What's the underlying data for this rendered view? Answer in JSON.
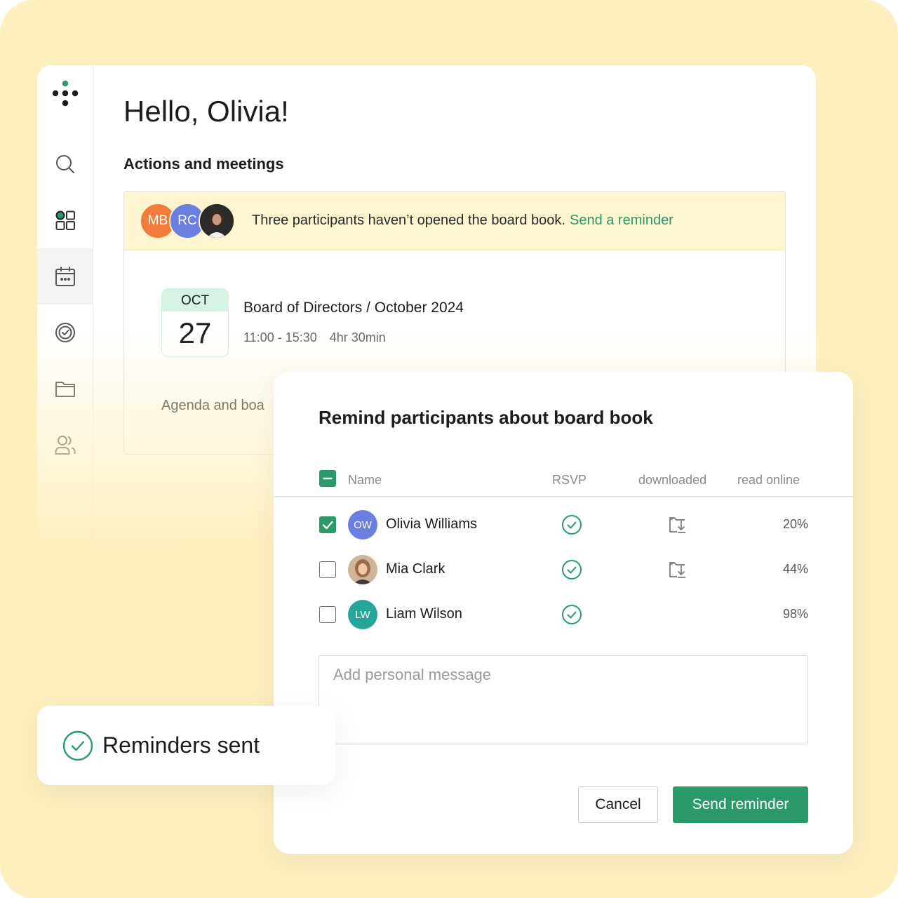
{
  "app": {
    "greeting": "Hello, Olivia!",
    "section_title": "Actions and meetings",
    "sidebar": {
      "items": [
        {
          "name": "search",
          "icon": "search-icon"
        },
        {
          "name": "dashboard",
          "icon": "grid-icon"
        },
        {
          "name": "calendar",
          "icon": "calendar-icon",
          "active": true
        },
        {
          "name": "tasks",
          "icon": "check-circle-icon"
        },
        {
          "name": "files",
          "icon": "folder-icon"
        },
        {
          "name": "people",
          "icon": "users-icon"
        }
      ]
    }
  },
  "notice": {
    "avatars": [
      {
        "initials": "MB",
        "color": "#f27c3a"
      },
      {
        "initials": "RC",
        "color": "#6b7fe0"
      },
      {
        "initials": "",
        "kind": "photo"
      }
    ],
    "text": "Three participants haven’t opened the board book.",
    "link": "Send a reminder"
  },
  "meeting": {
    "month": "OCT",
    "day": "27",
    "title": "Board of Directors / October 2024",
    "time": "11:00 - 15:30",
    "duration": "4hr 30min",
    "agenda_label": "Agenda and boa"
  },
  "modal": {
    "title": "Remind participants about board book",
    "columns": {
      "name": "Name",
      "rsvp": "RSVP",
      "downloaded": "downloaded",
      "read_online": "read online"
    },
    "header_checkbox": "indeterminate",
    "rows": [
      {
        "name": "Olivia Williams",
        "initials": "OW",
        "avatar_color": "#6b7fe0",
        "checked": true,
        "rsvp": true,
        "downloaded": true,
        "read_online": "20%"
      },
      {
        "name": "Mia Clark",
        "initials": "",
        "avatar_color": "#b58b6a",
        "checked": false,
        "rsvp": true,
        "downloaded": true,
        "read_online": "44%"
      },
      {
        "name": "Liam Wilson",
        "initials": "LW",
        "avatar_color": "#26a69a",
        "checked": false,
        "rsvp": true,
        "downloaded": false,
        "read_online": "98%"
      }
    ],
    "message_placeholder": "Add personal message",
    "cancel_label": "Cancel",
    "send_label": "Send reminder"
  },
  "toast": {
    "text": "Reminders sent"
  },
  "colors": {
    "background": "#fdf0bf",
    "accent": "#2b9a6b",
    "notice_bg": "#fdf5cf"
  }
}
